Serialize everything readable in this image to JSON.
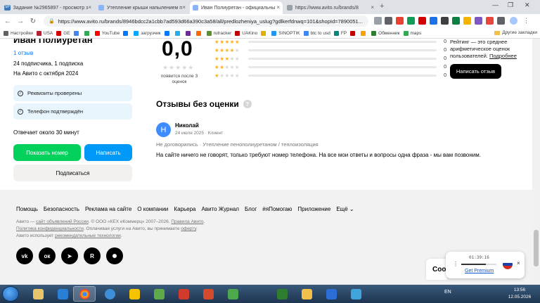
{
  "browser": {
    "tabs": [
      {
        "title": "Задание №2965897 - просмотр з",
        "favicon_color": "#3d7ab8",
        "favicon_text": "SP",
        "active": false
      },
      {
        "title": "Утепление крыши напылением п",
        "favicon_color": "#8ab4f8",
        "active": false
      },
      {
        "title": "Иван Полиуретан - официальны",
        "favicon_color": "#8ab4f8",
        "active": true
      },
      {
        "title": "https://www.avito.ru/brands/8",
        "favicon_color": "#9aa0a6",
        "active": false
      }
    ],
    "new_tab": "+",
    "url": "https://www.avito.ru/brands/8946bdcc2a1cbb7ad593d66a390c3a58/all/predlozheniya_uslug?gdlkerfdnwq=101&shopId=7890051...",
    "bookmarks": [
      {
        "label": "Настройки",
        "color": "#5f6368"
      },
      {
        "label": "USA",
        "color": "#b22234"
      },
      {
        "label": "GE",
        "color": "#d40000"
      },
      {
        "label": "",
        "color": "#4285f4"
      },
      {
        "label": "",
        "color": "#34a853"
      },
      {
        "label": "YouTube",
        "color": "#ff0000"
      },
      {
        "label": "",
        "color": "#0077ff"
      },
      {
        "label": "загрузчик",
        "color": "#00a8ff"
      },
      {
        "label": "",
        "color": "#0077ff"
      },
      {
        "label": "",
        "color": "#2aabee"
      },
      {
        "label": "",
        "color": "#6c2c91"
      },
      {
        "label": "",
        "color": "#ff6b00"
      },
      {
        "label": "rutracker",
        "color": "#5b8c3a"
      },
      {
        "label": "UAKino",
        "color": "#c00000"
      },
      {
        "label": "",
        "color": "#e0b000"
      },
      {
        "label": "SINOPTIK",
        "color": "#2196f3"
      },
      {
        "label": "btc to usd",
        "color": "#4285f4"
      },
      {
        "label": "FP",
        "color": "#00897b"
      },
      {
        "label": "",
        "color": "#c00000"
      },
      {
        "label": "",
        "color": "#ffa000"
      },
      {
        "label": "Обменник",
        "color": "#2e7d32"
      },
      {
        "label": "maps",
        "color": "#34a853"
      }
    ],
    "bookmarks_folder": "Другие закладки"
  },
  "seller": {
    "name": "Иван Полиуретан",
    "reviews_link": "1 отзыв",
    "subscribers": "24 подписчика, 1 подписка",
    "since": "На Авито с октября 2024",
    "verifications": [
      "Реквизиты проверены",
      "Телефон подтверждён"
    ],
    "response_time": "Отвечает около 30 минут",
    "show_phone": "Показать номер",
    "write": "Написать",
    "subscribe": "Подписаться"
  },
  "rating": {
    "score": "0,0",
    "note": "появится после 3 оценок",
    "distribution": [
      {
        "stars": 5,
        "count": "0"
      },
      {
        "stars": 4,
        "count": "0"
      },
      {
        "stars": 3,
        "count": "0"
      },
      {
        "stars": 2,
        "count": "0"
      },
      {
        "stars": 1,
        "count": "0"
      }
    ],
    "side_note_1": "Рейтинг — это среднее арифметическое оценок пользователей.",
    "side_note_link": "Подробнее",
    "write_review": "Написать отзыв"
  },
  "unrated": {
    "title": "Отзывы без оценки",
    "review": {
      "avatar": "Н",
      "author": "Николай",
      "meta": "24 июля 2025 · Клиент",
      "tag": "Не договорились · Утепление пенополиуретаном / теплоизоляция",
      "text": "На сайте ничего не говорят, только требуют номер телефона. На все мои ответы и вопросы одна фраза - мы вам позвоним."
    }
  },
  "footer": {
    "links": [
      "Помощь",
      "Безопасность",
      "Реклама на сайте",
      "О компании",
      "Карьера",
      "Авито Журнал",
      "Блог",
      "#яПомогаю",
      "Приложение",
      "Ещё ⌄"
    ],
    "legal_1a": "Авито — ",
    "legal_1b": "сайт объявлений России",
    "legal_1c": ". © ООО «КЕХ еКоммерц» 2007–2026. ",
    "legal_1d": "Правила Авито",
    "legal_1e": ".",
    "legal_2a": "Политика конфиденциальности",
    "legal_2b": ". Оплачивая услуги на Авито, вы принимаете ",
    "legal_2c": "оферту",
    "legal_2d": ".",
    "legal_3a": "Авито использует ",
    "legal_3b": "рекомендательные технологии",
    "legal_3c": ".",
    "socials": [
      "vk",
      "ok",
      "tg",
      "R",
      "dz"
    ]
  },
  "overlays": {
    "cookie_fragment": "Coo",
    "vpn_timer": "01:39:16",
    "vpn_premium": "Get Premium",
    "vpn_close": "×"
  },
  "taskbar": {
    "apps": [
      {
        "color": "#e7c56a",
        "active": false
      },
      {
        "color": "#2a7fd4",
        "active": false
      },
      {
        "color": "#e8453c",
        "active": true
      },
      {
        "color": "#3c8fd8",
        "active": false
      },
      {
        "color": "#f4c400",
        "active": false
      },
      {
        "color": "#5fa94b",
        "active": false
      },
      {
        "color": "#d03b2c",
        "active": false
      },
      {
        "color": "#d44a2e",
        "active": false
      },
      {
        "color": "#4da84d",
        "active": false
      },
      {
        "color": "#f2c04a",
        "active": false
      },
      {
        "color": "#2b6fd6",
        "active": false
      },
      {
        "color": "#3fa4d9",
        "active": false
      }
    ],
    "lang": "EN",
    "time": "13:56",
    "date": "12.05.2026"
  }
}
